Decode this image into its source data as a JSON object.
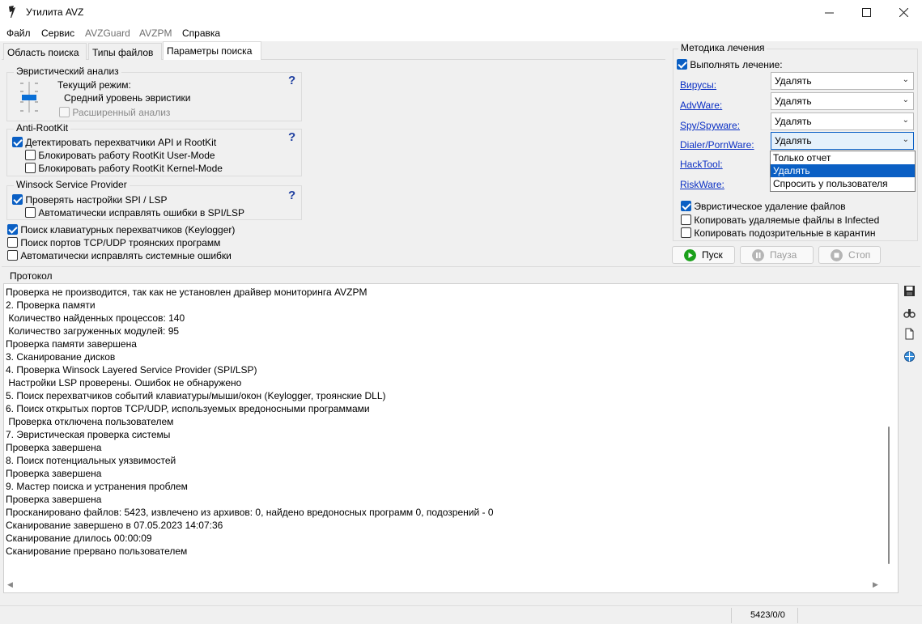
{
  "window": {
    "title": "Утилита AVZ"
  },
  "menu": {
    "file": "Файл",
    "service": "Сервис",
    "avzguard": "AVZGuard",
    "avzpm": "AVZPM",
    "help": "Справка"
  },
  "tabs": {
    "scope": "Область поиска",
    "filetypes": "Типы файлов",
    "params": "Параметры поиска"
  },
  "heuristic": {
    "title": "Эвристический анализ",
    "mode_label": "Текущий режим:",
    "mode_value": "Средний уровень эвристики",
    "extended": "Расширенный анализ",
    "help": "?"
  },
  "antirootkit": {
    "title": "Anti-RootKit",
    "detect": "Детектировать перехватчики API и RootKit",
    "block_user": "Блокировать работу RootKit User-Mode",
    "block_kernel": "Блокировать работу RootKit Kernel-Mode",
    "help": "?"
  },
  "winsock": {
    "title": "Winsock  Service Provider",
    "check": "Проверять настройки SPI / LSP",
    "autofix": "Автоматически исправлять ошибки в SPI/LSP",
    "help": "?"
  },
  "options": {
    "keylogger": "Поиск клавиатурных перехватчиков (Keylogger)",
    "ports": "Поиск портов TCP/UDP троянских программ",
    "autofix_sys": "Автоматически исправлять системные ошибки"
  },
  "treatment": {
    "title": "Методика лечения",
    "perform": "Выполнять лечение:",
    "rows": [
      {
        "label": "Вирусы:",
        "value": "Удалять"
      },
      {
        "label": "AdvWare:",
        "value": "Удалять"
      },
      {
        "label": "Spy/Spyware:",
        "value": "Удалять"
      },
      {
        "label": "Dialer/PornWare:",
        "value": "Удалять"
      },
      {
        "label": "HackTool:"
      },
      {
        "label": "RiskWare:"
      }
    ],
    "dropdown_options": [
      "Только отчет",
      "Удалять",
      "Спросить у пользователя"
    ],
    "heur_delete": "Эвристическое удаление файлов",
    "copy_infected": "Копировать удаляемые файлы в  Infected",
    "copy_quarantine": "Копировать подозрительные в  карантин"
  },
  "buttons": {
    "start": "Пуск",
    "pause": "Пауза",
    "stop": "Стоп"
  },
  "protocol": {
    "title": "Протокол",
    "lines": [
      "Проверка не производится, так как не установлен драйвер мониторинга AVZPM",
      "2. Проверка памяти",
      " Количество найденных процессов: 140",
      " Количество загруженных модулей: 95",
      "Проверка памяти завершена",
      "3. Сканирование дисков",
      "4. Проверка Winsock Layered Service Provider (SPI/LSP)",
      " Настройки LSP проверены. Ошибок не обнаружено",
      "5. Поиск перехватчиков событий клавиатуры/мыши/окон (Keylogger, троянские DLL)",
      "6. Поиск открытых портов TCP/UDP, используемых вредоносными программами",
      " Проверка отключена пользователем",
      "7. Эвристическая проверка системы",
      "Проверка завершена",
      "8. Поиск потенциальных уязвимостей",
      "Проверка завершена",
      "9. Мастер поиска и устранения проблем",
      "Проверка завершена",
      "Просканировано файлов: 5423, извлечено из архивов: 0, найдено вредоносных программ 0, подозрений - 0",
      "Сканирование завершено в 07.05.2023 14:07:36",
      "Сканирование длилось 00:00:09",
      "Сканирование прервано пользователем"
    ]
  },
  "status": {
    "counts": "5423/0/0"
  }
}
